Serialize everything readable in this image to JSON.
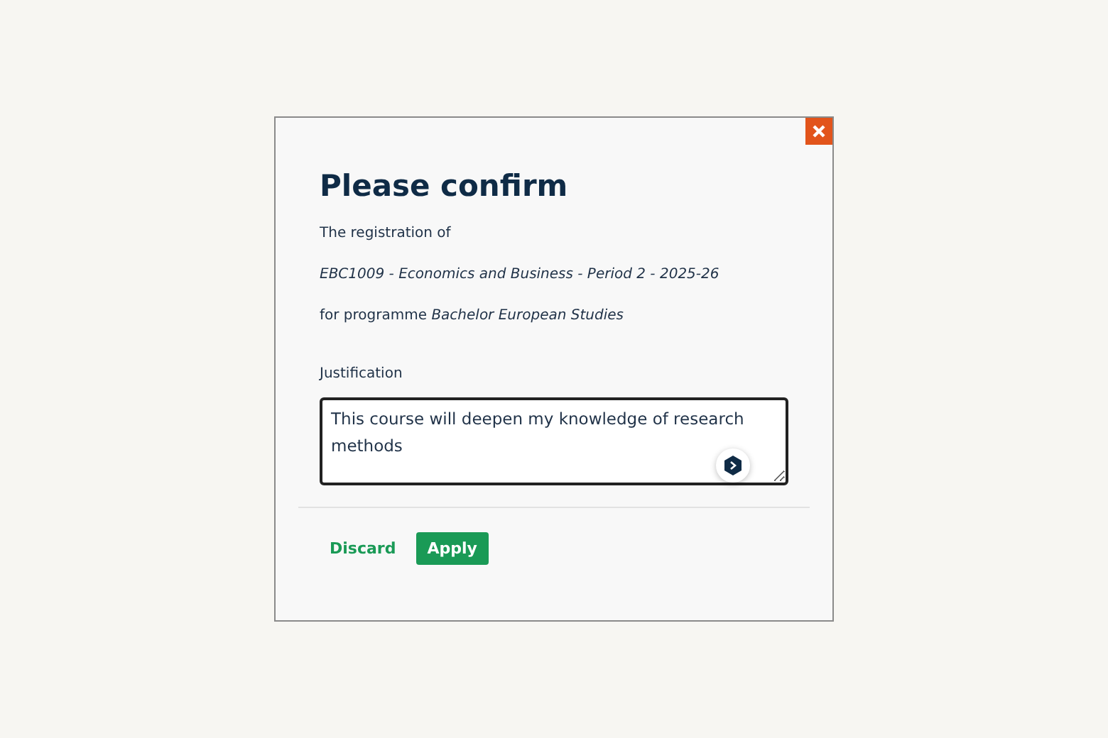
{
  "dialog": {
    "title": "Please confirm",
    "intro": "The registration of",
    "course": "EBC1009 - Economics and Business - Period 2 - 2025-26",
    "programme": "for programme *Bachelor European Studies*",
    "justification": {
      "label": "Justification",
      "value": "This course will deepen my knowledge of research methods"
    },
    "buttons": [
      {
        "label": "Discard",
        "kind": "link"
      },
      {
        "label": "Apply",
        "kind": "primary"
      }
    ]
  }
}
